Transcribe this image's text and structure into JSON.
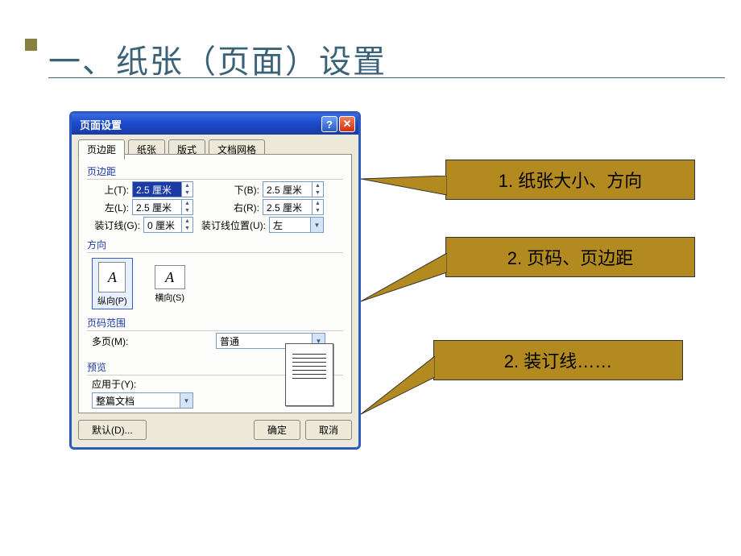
{
  "slide": {
    "title": "一、纸张（页面）设置"
  },
  "dialog": {
    "title": "页面设置",
    "tabs": {
      "margins": "页边距",
      "paper": "纸张",
      "layout": "版式",
      "grid": "文档网格"
    },
    "section_margins": "页边距",
    "labels": {
      "top": "上(T):",
      "bottom": "下(B):",
      "left": "左(L):",
      "right": "右(R):",
      "gutter": "装订线(G):",
      "gutter_pos": "装订线位置(U):"
    },
    "values": {
      "top": "2.5 厘米",
      "bottom": "2.5 厘米",
      "left": "2.5 厘米",
      "right": "2.5 厘米",
      "gutter": "0 厘米",
      "gutter_pos": "左"
    },
    "section_orientation": "方向",
    "orientation": {
      "portrait": "纵向(P)",
      "landscape": "横向(S)"
    },
    "section_pages": "页码范围",
    "multipage_label": "多页(M):",
    "multipage_value": "普通",
    "section_preview": "预览",
    "applyto_label": "应用于(Y):",
    "applyto_value": "整篇文档",
    "buttons": {
      "default": "默认(D)...",
      "ok": "确定",
      "cancel": "取消"
    }
  },
  "callouts": {
    "c1": "1. 纸张大小、方向",
    "c2": "2. 页码、页边距",
    "c3": "2. 装订线……"
  }
}
